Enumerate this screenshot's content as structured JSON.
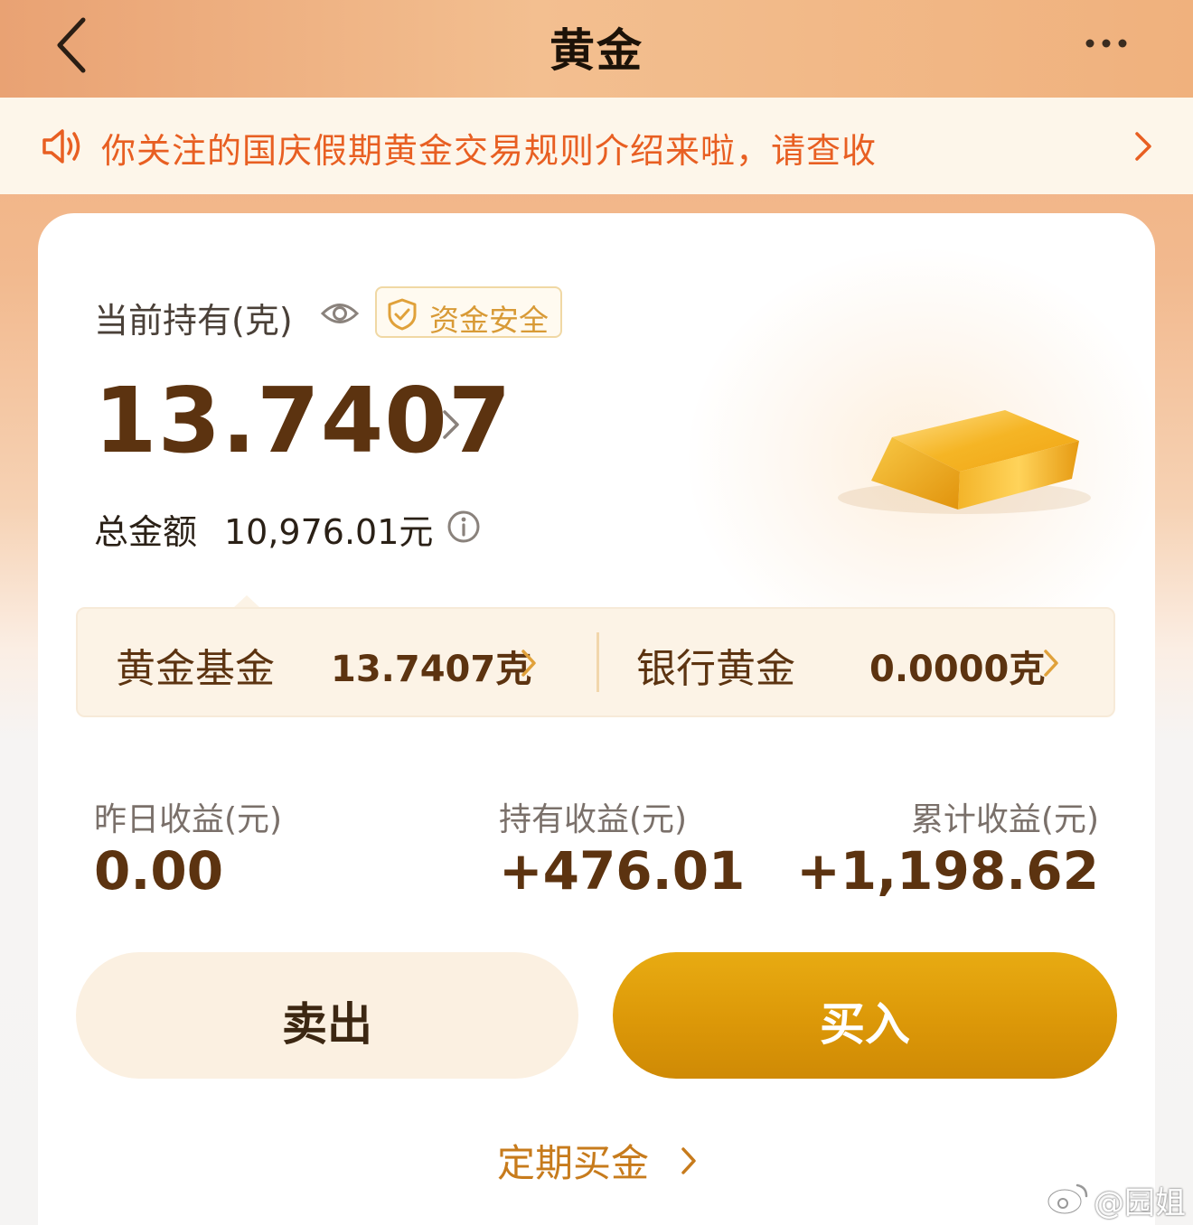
{
  "header": {
    "title": "黄金",
    "back_icon": "chevron-left-icon",
    "more_icon": "more-icon"
  },
  "notice": {
    "icon": "speaker-icon",
    "text": "你关注的国庆假期黄金交易规则介绍来啦，请查收",
    "arrow_icon": "chevron-right-icon",
    "color": "#e85f22"
  },
  "holding": {
    "label": "当前持有(克)",
    "eye_icon": "eye-icon",
    "safe_badge": "资金安全",
    "amount_grams": "13.7407",
    "total_label": "总金额",
    "total_value": "10,976.01元",
    "info_icon": "info-icon"
  },
  "products": [
    {
      "name": "黄金基金",
      "value": "13.7407克"
    },
    {
      "name": "银行黄金",
      "value": "0.0000克"
    }
  ],
  "stats": [
    {
      "label": "昨日收益(元)",
      "value": "0.00"
    },
    {
      "label": "持有收益(元)",
      "value": "+476.01"
    },
    {
      "label": "累计收益(元)",
      "value": "+1,198.62"
    }
  ],
  "actions": {
    "sell_label": "卖出",
    "buy_label": "买入",
    "buy_color": "#dc9808",
    "regular_label": "定期买金"
  },
  "watermark": {
    "text": "@园姐"
  }
}
